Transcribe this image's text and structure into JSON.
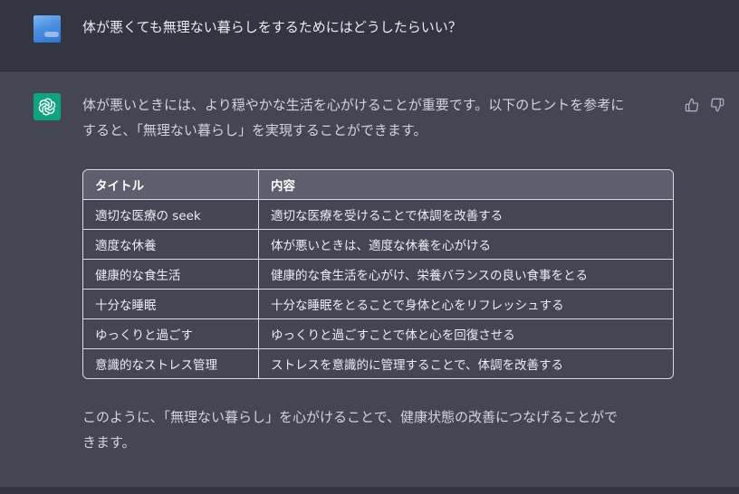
{
  "conversation": {
    "user_message": "体が悪くても無理ない暮らしをするためにはどうしたらいい？",
    "assistant": {
      "intro_line1": "体が悪いときには、より穏やかな生活を心がけることが重要です。以下のヒントを参考に",
      "intro_line2": "すると、「無理ない暮らし」を実現することができます。",
      "table": {
        "headers": [
          "タイトル",
          "内容"
        ],
        "rows": [
          [
            "適切な医療の seek",
            "適切な医療を受けることで体調を改善する"
          ],
          [
            "適度な休養",
            "体が悪いときは、適度な休養を心がける"
          ],
          [
            "健康的な食生活",
            "健康的な食生活を心がけ、栄養バランスの良い食事をとる"
          ],
          [
            "十分な睡眠",
            "十分な睡眠をとることで身体と心をリフレッシュする"
          ],
          [
            "ゆっくりと過ごす",
            "ゆっくりと過ごすことで体と心を回復させる"
          ],
          [
            "意識的なストレス管理",
            "ストレスを意識的に管理することで、体調を改善する"
          ]
        ]
      },
      "closing_line1": "このように、「無理ない暮らし」を心がけることで、健康状態の改善につなげることがで",
      "closing_line2": "きます。"
    }
  },
  "icons": {
    "user_avatar": "user-avatar-image",
    "assistant_avatar": "openai-logo-icon",
    "thumbs_up": "thumbs-up-icon",
    "thumbs_down": "thumbs-down-icon"
  },
  "colors": {
    "user_bg": "#343541",
    "assistant_bg": "#444654",
    "assistant_avatar_bg": "#10a37f",
    "table_header_bg": "#5d5f6e"
  }
}
